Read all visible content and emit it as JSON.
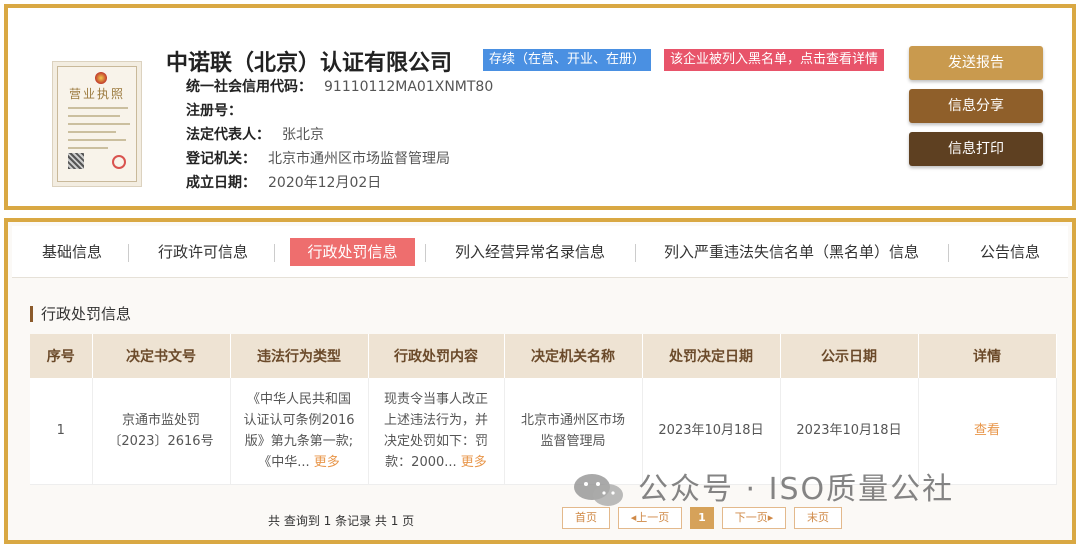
{
  "company": {
    "name": "中诺联（北京）认证有限公司",
    "status_tag": "存续（在营、开业、在册）",
    "blacklist_tag": "该企业被列入黑名单，点击查看详情",
    "license_title": "营业执照",
    "fields": [
      {
        "label": "统一社会信用代码：",
        "value": "91110112MA01XNMT80"
      },
      {
        "label": "注册号：",
        "value": ""
      },
      {
        "label": "法定代表人：",
        "value": "张北京"
      },
      {
        "label": "登记机关：",
        "value": "北京市通州区市场监督管理局"
      },
      {
        "label": "成立日期：",
        "value": "2020年12月02日"
      }
    ]
  },
  "actions": {
    "send_report": "发送报告",
    "share": "信息分享",
    "print": "信息打印"
  },
  "tabs": [
    {
      "label": "基础信息"
    },
    {
      "label": "行政许可信息"
    },
    {
      "label": "行政处罚信息",
      "active": true
    },
    {
      "label": "列入经营异常名录信息"
    },
    {
      "label": "列入严重违法失信名单（黑名单）信息"
    },
    {
      "label": "公告信息"
    }
  ],
  "section_title": "行政处罚信息",
  "table": {
    "headers": [
      "序号",
      "决定书文号",
      "违法行为类型",
      "行政处罚内容",
      "决定机关名称",
      "处罚决定日期",
      "公示日期",
      "详情"
    ],
    "rows": [
      {
        "index": "1",
        "doc_no": "京通市监处罚〔2023〕2616号",
        "violation_type": "《中华人民共和国认证认可条例2016版》第九条第一款;《中华...",
        "penalty_content": "现责令当事人改正上述违法行为，并决定处罚如下：罚款：2000...",
        "authority": "北京市通州区市场监督管理局",
        "decision_date": "2023年10月18日",
        "publish_date": "2023年10月18日",
        "detail": "查看"
      }
    ],
    "more_label": "更多"
  },
  "pager": {
    "summary": "共 查询到 1 条记录 共 1 页",
    "first": "首页",
    "prev": "◂上一页",
    "current": "1",
    "next": "下一页▸",
    "last": "末页"
  },
  "watermark": "公众号 · ISO质量公社",
  "colors": {
    "frame": "#d9a843",
    "status_blue": "#4a90e2",
    "blacklist_red": "#e8546a",
    "btn_gold": "#c99a4e",
    "btn_brown": "#8f5f2a",
    "btn_dark": "#5e4021",
    "tab_active": "#ee6e6e"
  }
}
